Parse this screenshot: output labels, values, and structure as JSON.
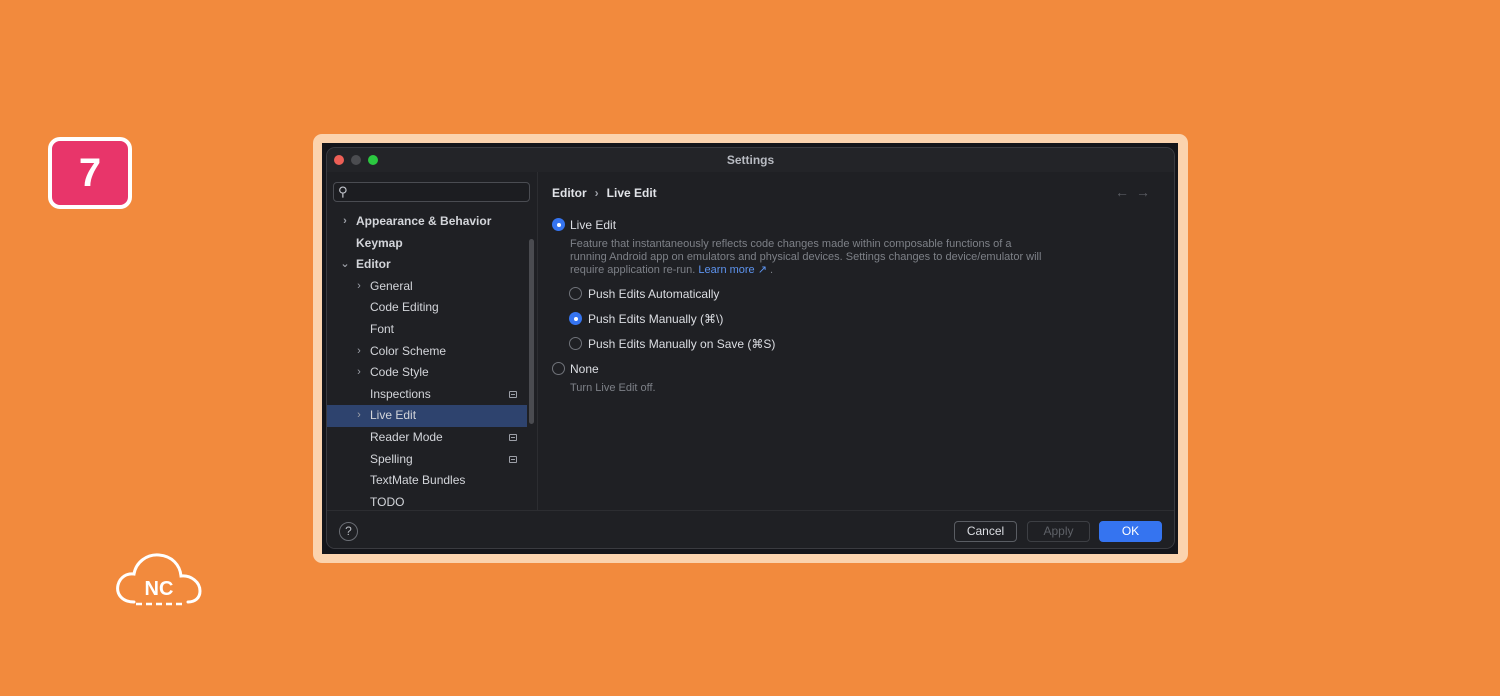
{
  "badge": {
    "number": "7"
  },
  "logo": {
    "text": "NC"
  },
  "window": {
    "title": "Settings"
  },
  "search": {
    "placeholder": ""
  },
  "sidebar": {
    "items": [
      {
        "label": "Appearance & Behavior",
        "chevron": "›"
      },
      {
        "label": "Keymap"
      },
      {
        "label": "Editor",
        "chevron": "⌄"
      },
      {
        "label": "General",
        "chevron": "›"
      },
      {
        "label": "Code Editing"
      },
      {
        "label": "Font"
      },
      {
        "label": "Color Scheme",
        "chevron": "›"
      },
      {
        "label": "Code Style",
        "chevron": "›"
      },
      {
        "label": "Inspections"
      },
      {
        "label": "Live Edit",
        "chevron": "›"
      },
      {
        "label": "Reader Mode"
      },
      {
        "label": "Spelling"
      },
      {
        "label": "TextMate Bundles"
      },
      {
        "label": "TODO"
      }
    ]
  },
  "breadcrumb": {
    "parent": "Editor",
    "separator": "›",
    "current": "Live Edit"
  },
  "nav": {
    "back": "←",
    "forward": "→"
  },
  "content": {
    "live_edit": {
      "label": "Live Edit",
      "desc_line1": "Feature that instantaneously reflects code changes made within composable functions of a",
      "desc_line2": "running Android app on emulators and physical devices. Settings changes to device/emulator will",
      "desc_line3": "require application re-run.",
      "learn_more": "Learn more ↗",
      "desc_end": "."
    },
    "option_auto": "Push Edits Automatically",
    "option_manual": "Push Edits Manually (⌘\\)",
    "option_save": "Push Edits Manually on Save (⌘S)",
    "none": {
      "label": "None",
      "desc": "Turn Live Edit off."
    }
  },
  "footer": {
    "help": "?",
    "cancel": "Cancel",
    "apply": "Apply",
    "ok": "OK"
  },
  "colors": {
    "background": "#F28A3D",
    "badge": "#E8356A",
    "accent": "#3574F0",
    "selection": "#2E436E"
  }
}
